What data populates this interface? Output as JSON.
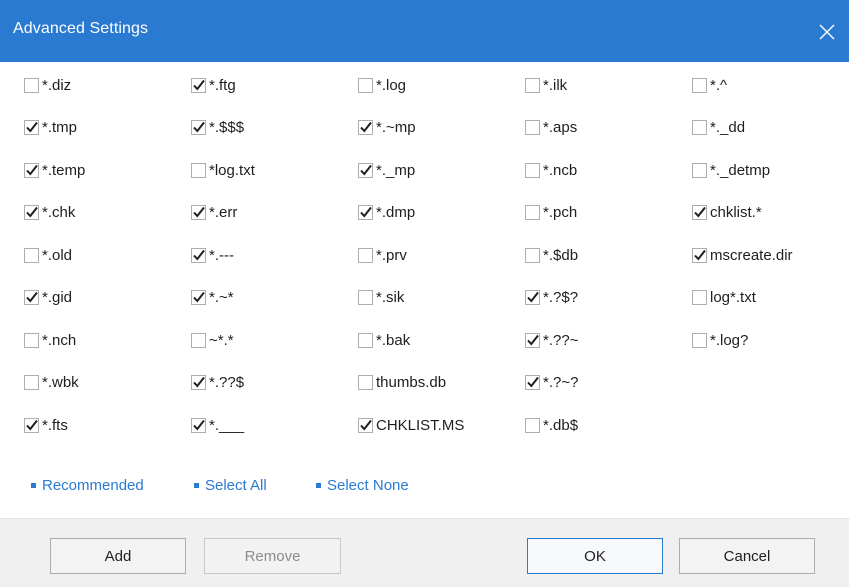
{
  "window": {
    "title": "Advanced Settings",
    "accent": "#2a7ad2"
  },
  "close_icon": "close-icon",
  "columns": [
    {
      "items": [
        {
          "label": "*.diz",
          "checked": false
        },
        {
          "label": "*.tmp",
          "checked": true
        },
        {
          "label": "*.temp",
          "checked": true
        },
        {
          "label": "*.chk",
          "checked": true
        },
        {
          "label": "*.old",
          "checked": false
        },
        {
          "label": "*.gid",
          "checked": true
        },
        {
          "label": "*.nch",
          "checked": false
        },
        {
          "label": "*.wbk",
          "checked": false
        },
        {
          "label": "*.fts",
          "checked": true
        }
      ]
    },
    {
      "items": [
        {
          "label": "*.ftg",
          "checked": true
        },
        {
          "label": "*.$$$",
          "checked": true
        },
        {
          "label": "*log.txt",
          "checked": false
        },
        {
          "label": "*.err",
          "checked": true
        },
        {
          "label": "*.---",
          "checked": true
        },
        {
          "label": "*.~*",
          "checked": true
        },
        {
          "label": "~*.*",
          "checked": false
        },
        {
          "label": "*.??$",
          "checked": true
        },
        {
          "label": "*.___",
          "checked": true
        }
      ]
    },
    {
      "items": [
        {
          "label": "*.log",
          "checked": false
        },
        {
          "label": "*.~mp",
          "checked": true
        },
        {
          "label": "*._mp",
          "checked": true
        },
        {
          "label": "*.dmp",
          "checked": true
        },
        {
          "label": "*.prv",
          "checked": false
        },
        {
          "label": "*.sik",
          "checked": false
        },
        {
          "label": "*.bak",
          "checked": false
        },
        {
          "label": "thumbs.db",
          "checked": false
        },
        {
          "label": "CHKLIST.MS",
          "checked": true
        }
      ]
    },
    {
      "items": [
        {
          "label": "*.ilk",
          "checked": false
        },
        {
          "label": "*.aps",
          "checked": false
        },
        {
          "label": "*.ncb",
          "checked": false
        },
        {
          "label": "*.pch",
          "checked": false
        },
        {
          "label": "*.$db",
          "checked": false
        },
        {
          "label": "*.?$?",
          "checked": true
        },
        {
          "label": "*.??~",
          "checked": true
        },
        {
          "label": "*.?~?",
          "checked": true
        },
        {
          "label": "*.db$",
          "checked": false
        }
      ]
    },
    {
      "items": [
        {
          "label": "*.^",
          "checked": false
        },
        {
          "label": "*._dd",
          "checked": false
        },
        {
          "label": "*._detmp",
          "checked": false
        },
        {
          "label": "chklist.*",
          "checked": true
        },
        {
          "label": "mscreate.dir",
          "checked": true
        },
        {
          "label": "log*.txt",
          "checked": false
        },
        {
          "label": "*.log?",
          "checked": false
        }
      ]
    }
  ],
  "links": {
    "recommended": "Recommended",
    "select_all": "Select All",
    "select_none": "Select None"
  },
  "buttons": {
    "add": "Add",
    "remove": "Remove",
    "ok": "OK",
    "cancel": "Cancel"
  }
}
